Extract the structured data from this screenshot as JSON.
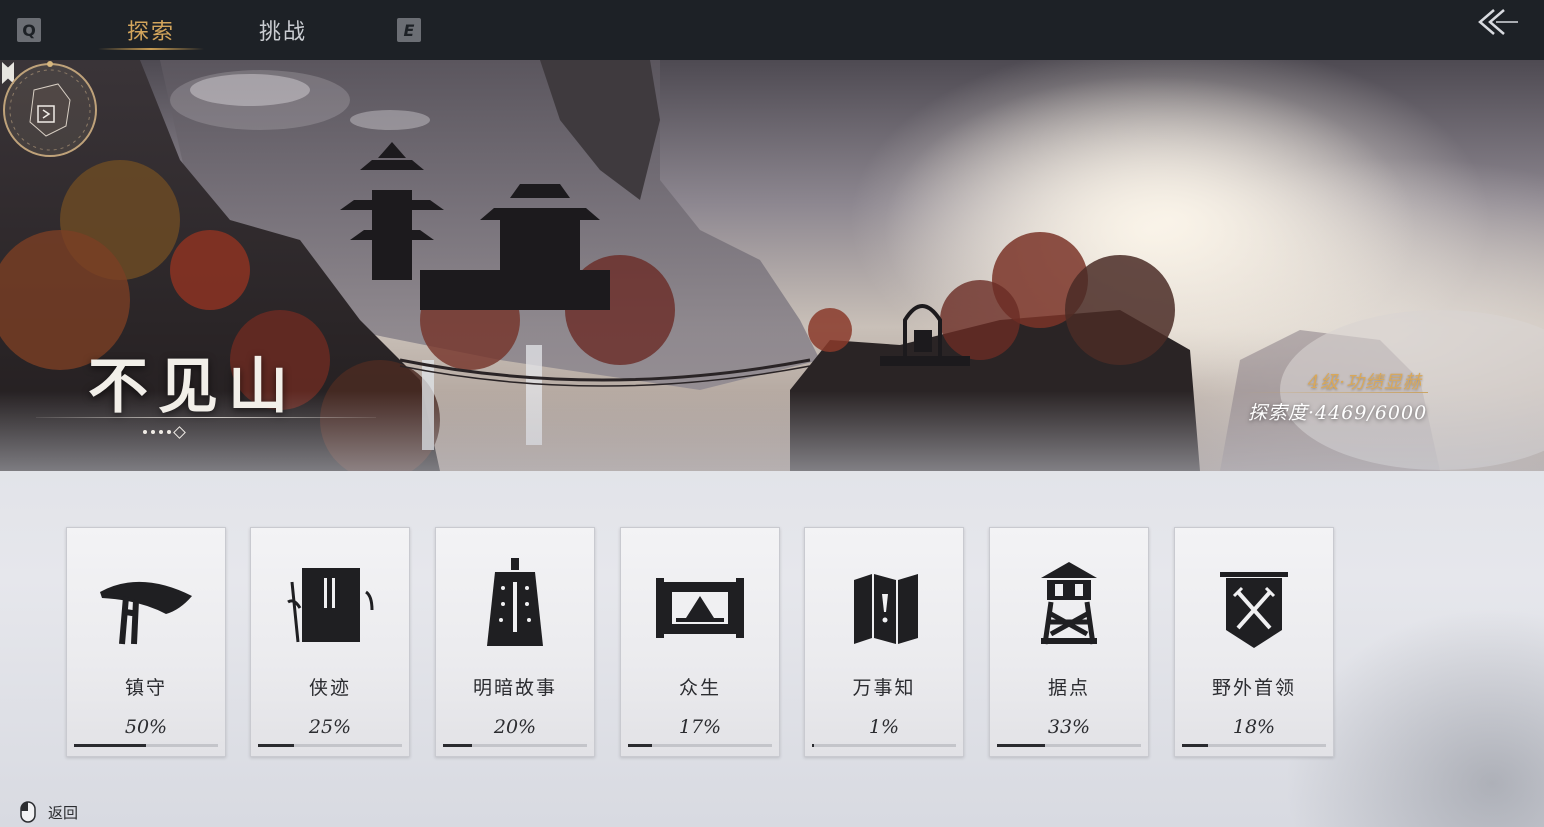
{
  "top_bar": {
    "left_key": "Q",
    "right_key": "E",
    "tabs": [
      {
        "label": "探索",
        "active": true
      },
      {
        "label": "挑战",
        "active": false
      }
    ],
    "back_icon": "double-chevron-left-icon"
  },
  "region": {
    "name": "不见山",
    "page_count": 5,
    "current_page": 5,
    "level_text": "4级·功绩显赫",
    "exploration_label": "探索度",
    "exploration_value": "4469/6000"
  },
  "categories": [
    {
      "label": "镇守",
      "percent_text": "50%",
      "progress": 0.5,
      "icon": "umbrella-hat-icon"
    },
    {
      "label": "侠迹",
      "percent_text": "25%",
      "progress": 0.25,
      "icon": "book-bamboo-icon"
    },
    {
      "label": "明暗故事",
      "percent_text": "20%",
      "progress": 0.2,
      "icon": "bell-icon"
    },
    {
      "label": "众生",
      "percent_text": "17%",
      "progress": 0.17,
      "icon": "scroll-painting-icon"
    },
    {
      "label": "万事知",
      "percent_text": "1%",
      "progress": 0.01,
      "icon": "open-map-icon"
    },
    {
      "label": "据点",
      "percent_text": "33%",
      "progress": 0.33,
      "icon": "watchtower-icon"
    },
    {
      "label": "野外首领",
      "percent_text": "18%",
      "progress": 0.18,
      "icon": "crossed-swords-banner-icon"
    }
  ],
  "footer": {
    "icon": "mouse-right-click-icon",
    "label": "返回"
  },
  "colors": {
    "accent_gold": "#d3a55c",
    "topbar_bg": "#1d2126",
    "progress_fill": "#2a2b2f"
  }
}
